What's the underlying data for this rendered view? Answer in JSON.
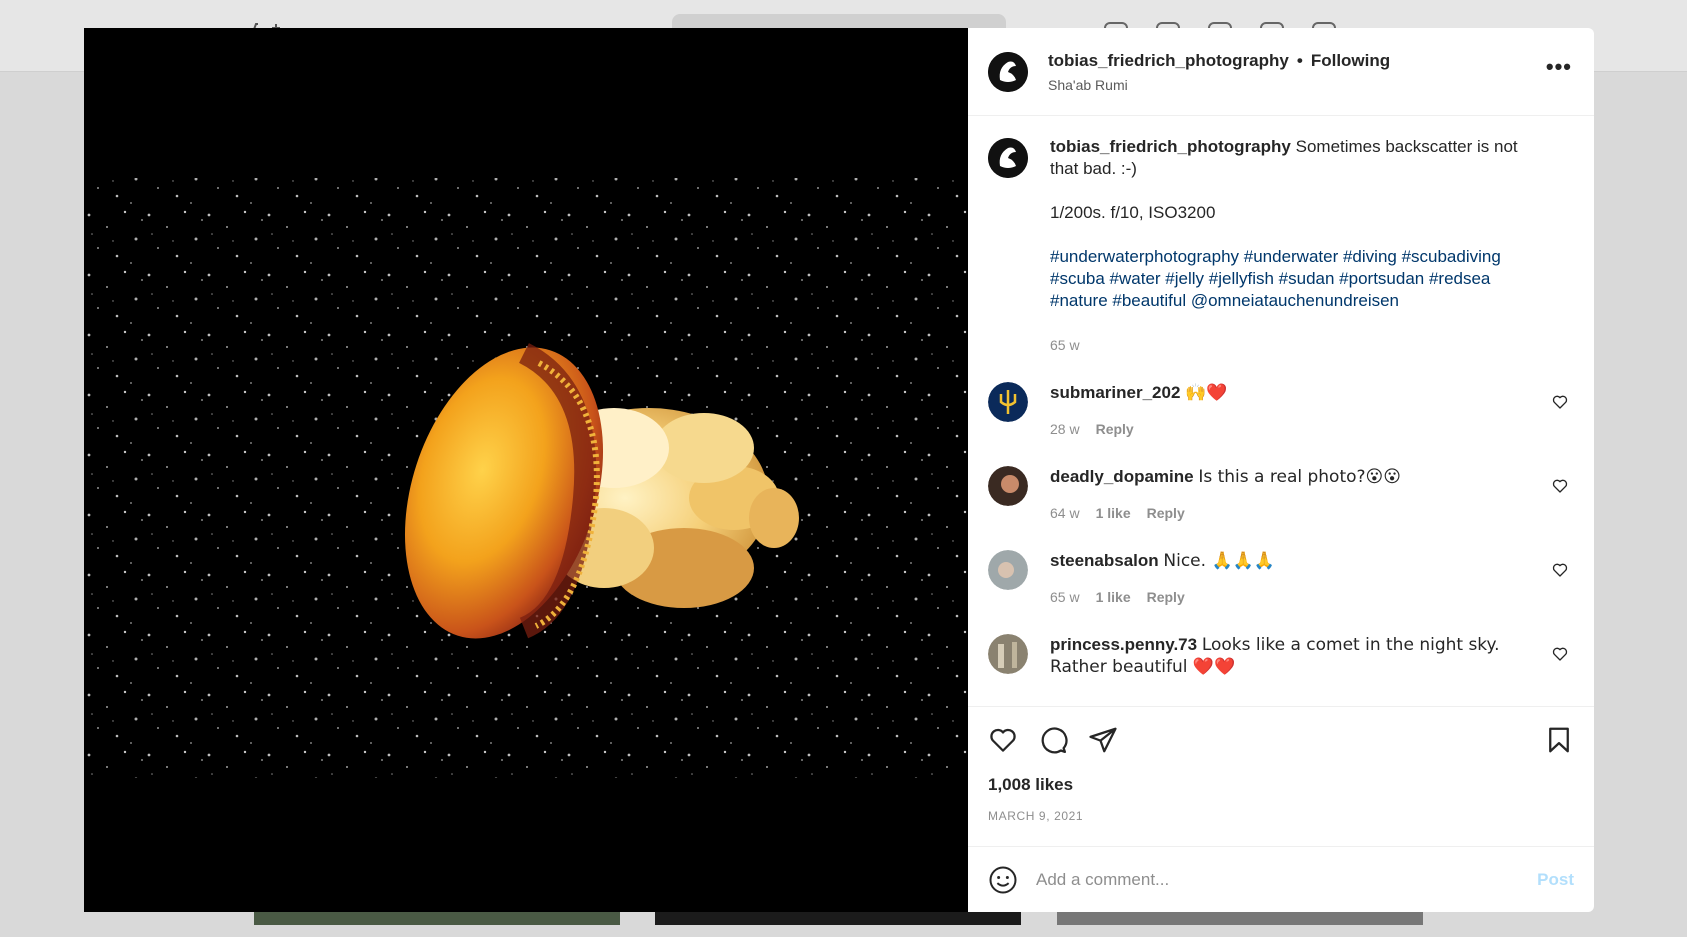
{
  "post": {
    "username": "tobias_friedrich_photography",
    "separator": "•",
    "follow_status": "Following",
    "location": "Sha'ab Rumi",
    "more": "•••",
    "caption_text": "Sometimes backscatter is not that bad. :-)",
    "caption_settings": "1/200s. f/10, ISO3200",
    "caption_tags_line1": "#underwaterphotography #underwater #diving #scubadiving",
    "caption_tags_line2": "#scuba #water #jelly #jellyfish #sudan #portsudan #redsea",
    "caption_tags_line3": "#nature #beautiful @omneiatauchenundreisen",
    "caption_time": "65 w",
    "likes": "1,008 likes",
    "date": "MARCH 9, 2021"
  },
  "comments": [
    {
      "username": "submariner_202",
      "text": "🙌❤️",
      "time": "28 w",
      "likes": "",
      "reply": "Reply"
    },
    {
      "username": "deadly_dopamine",
      "text": "Is this a real photo?😮😮",
      "time": "64 w",
      "likes": "1 like",
      "reply": "Reply"
    },
    {
      "username": "steenabsalon",
      "text": "Nice. 🙏🙏🙏",
      "time": "65 w",
      "likes": "1 like",
      "reply": "Reply"
    },
    {
      "username": "princess.penny.73",
      "text": "Looks like a comet in the night sky. Rather beautiful ❤️❤️",
      "time": "",
      "likes": "",
      "reply": ""
    }
  ],
  "composer": {
    "placeholder": "Add a comment...",
    "post_label": "Post"
  },
  "icons": {
    "like": "heart-icon",
    "comment": "comment-icon",
    "share": "share-icon",
    "save": "bookmark-icon",
    "emoji": "emoji-icon"
  },
  "colors": {
    "link": "#00376b",
    "muted": "#8e8e8e",
    "post_disabled": "#b2dffc"
  }
}
